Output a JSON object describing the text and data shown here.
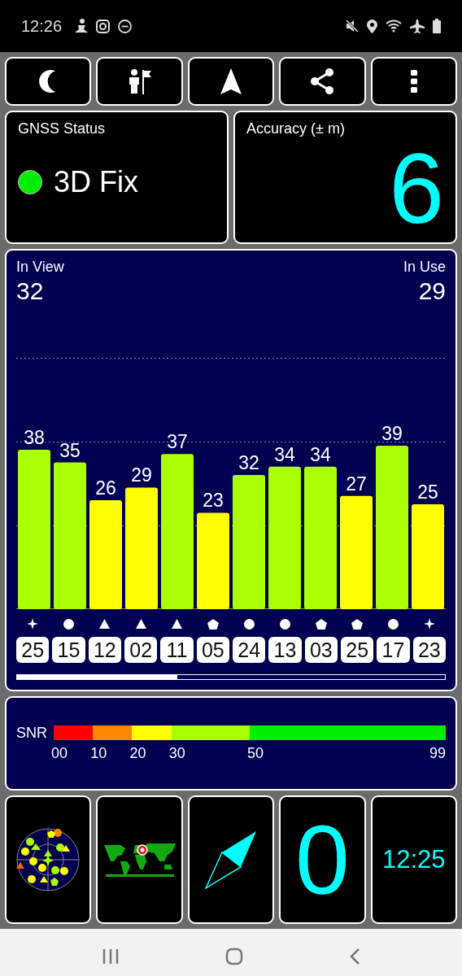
{
  "status_bar": {
    "time": "12:26"
  },
  "toolbar": [
    {
      "kind": "night"
    },
    {
      "kind": "waypoint"
    },
    {
      "kind": "navigate"
    },
    {
      "kind": "share"
    },
    {
      "kind": "more"
    }
  ],
  "gnss_status": {
    "title": "GNSS Status",
    "fix": "3D Fix",
    "color": "#00ee00"
  },
  "accuracy": {
    "title": "Accuracy (± m)",
    "value": "6"
  },
  "satellites": {
    "in_view_label": "In View",
    "in_view": "32",
    "in_use_label": "In Use",
    "in_use": "29",
    "chart_data": {
      "type": "bar",
      "categories": [
        "25",
        "15",
        "12",
        "02",
        "11",
        "05",
        "24",
        "13",
        "03",
        "25",
        "17",
        "23"
      ],
      "values": [
        38,
        35,
        26,
        29,
        37,
        23,
        32,
        34,
        34,
        27,
        39,
        25
      ],
      "data_labels": true
    },
    "shapes": [
      {
        "kind": "star"
      },
      {
        "kind": "circle"
      },
      {
        "kind": "triangle"
      },
      {
        "kind": "triangle"
      },
      {
        "kind": "triangle"
      },
      {
        "kind": "pentagon"
      },
      {
        "kind": "circle"
      },
      {
        "kind": "circle"
      },
      {
        "kind": "pentagon"
      },
      {
        "kind": "pentagon"
      },
      {
        "kind": "circle"
      },
      {
        "kind": "star"
      }
    ]
  },
  "snr_scale": {
    "label": "SNR",
    "segments": [
      {
        "label": "00",
        "color": "#ff0000"
      },
      {
        "label": "10",
        "color": "#ff8800"
      },
      {
        "label": "20",
        "color": "#ffff00"
      },
      {
        "label": "30",
        "color": "#aaff00"
      },
      {
        "label": "50",
        "color": "#00ee00"
      }
    ],
    "end_label": "99"
  },
  "tiles": [
    {
      "kind": "skyplot"
    },
    {
      "kind": "map"
    },
    {
      "kind": "compass"
    },
    {
      "kind": "value",
      "text": "0"
    },
    {
      "kind": "clock",
      "text": "12:25"
    }
  ]
}
